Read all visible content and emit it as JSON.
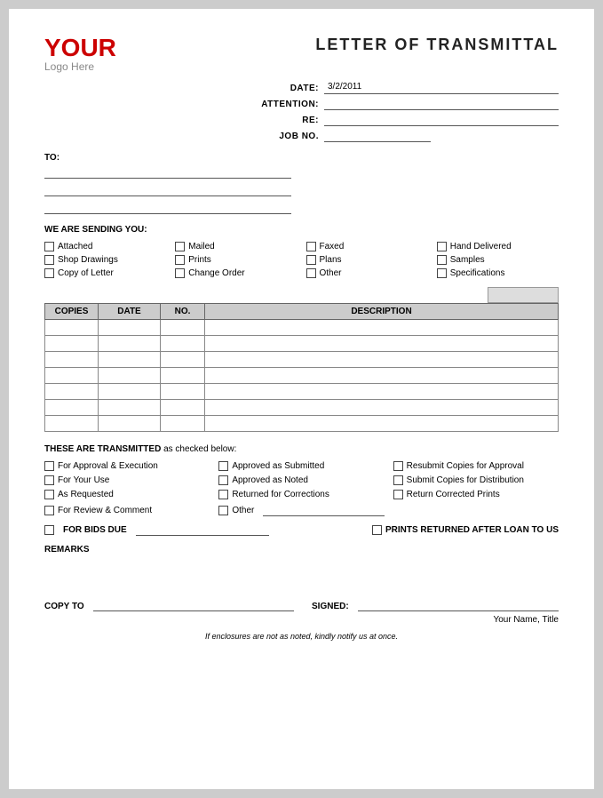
{
  "logo": {
    "your": "YOUR",
    "sub": "Logo Here"
  },
  "title": "LETTER OF TRANSMITTAL",
  "date_label": "DATE:",
  "date_value": "3/2/2011",
  "attention_label": "ATTENTION:",
  "re_label": "RE:",
  "job_no_label": "JOB NO.",
  "to_label": "TO:",
  "we_are_sending": "WE ARE SENDING YOU:",
  "checkboxes": [
    {
      "label": "Attached"
    },
    {
      "label": "Mailed"
    },
    {
      "label": "Faxed"
    },
    {
      "label": "Hand Delivered"
    },
    {
      "label": "Shop Drawings"
    },
    {
      "label": "Prints"
    },
    {
      "label": "Plans"
    },
    {
      "label": "Samples"
    },
    {
      "label": "Copy of Letter"
    },
    {
      "label": "Change Order"
    },
    {
      "label": "Other"
    },
    {
      "label": "Specifications"
    }
  ],
  "table": {
    "headers": [
      "COPIES",
      "DATE",
      "NO.",
      "DESCRIPTION"
    ],
    "rows": [
      {
        "copies": "",
        "date": "",
        "no": "",
        "description": ""
      },
      {
        "copies": "",
        "date": "",
        "no": "",
        "description": ""
      },
      {
        "copies": "",
        "date": "",
        "no": "",
        "description": ""
      },
      {
        "copies": "",
        "date": "",
        "no": "",
        "description": ""
      },
      {
        "copies": "",
        "date": "",
        "no": "",
        "description": ""
      },
      {
        "copies": "",
        "date": "",
        "no": "",
        "description": ""
      },
      {
        "copies": "",
        "date": "",
        "no": "",
        "description": ""
      }
    ]
  },
  "transmitted_label_1": "THESE ARE TRANSMITTED",
  "transmitted_label_2": "as checked below:",
  "transmitted_items": [
    {
      "label": "For Approval & Execution"
    },
    {
      "label": "Approved as Submitted"
    },
    {
      "label": "Resubmit Copies for Approval"
    },
    {
      "label": "For Your Use"
    },
    {
      "label": "Approved as Noted"
    },
    {
      "label": "Submit Copies for Distribution"
    },
    {
      "label": "As Requested"
    },
    {
      "label": "Returned for Corrections"
    },
    {
      "label": "Return Corrected Prints"
    },
    {
      "label": "For Review & Comment"
    },
    {
      "label": "Other"
    },
    {
      "label": ""
    }
  ],
  "bids_due_label": "FOR BIDS DUE",
  "prints_returned_label": "PRINTS RETURNED AFTER LOAN TO US",
  "remarks_label": "REMARKS",
  "copy_to_label": "COPY TO",
  "signed_label": "SIGNED:",
  "name_title": "Your Name, Title",
  "footer_note": "If enclosures are not as noted, kindly notify us at once."
}
